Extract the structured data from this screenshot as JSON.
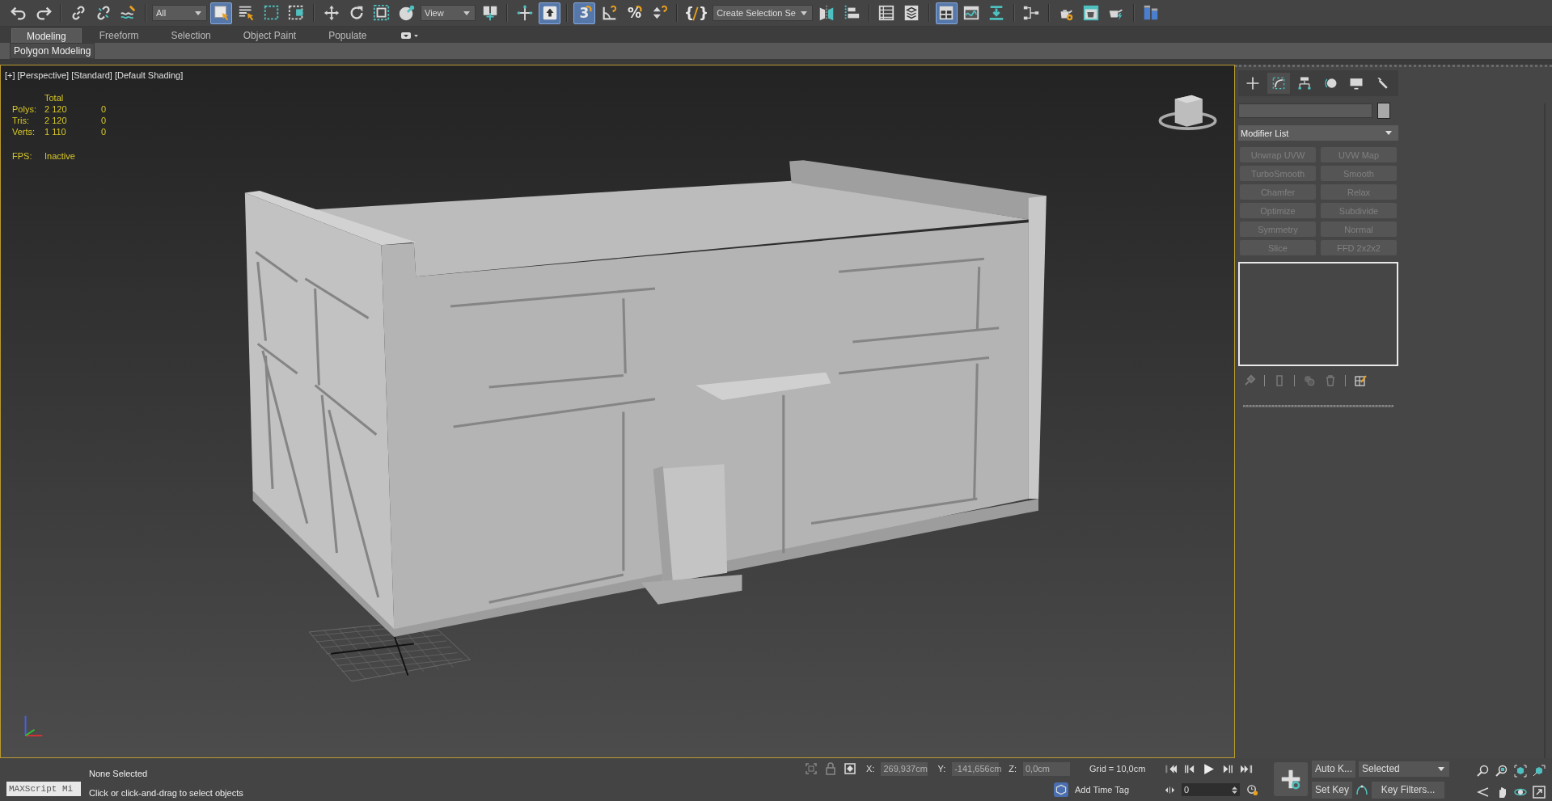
{
  "toolbar": [
    {
      "kind": "undo",
      "selected": false
    },
    {
      "kind": "redo",
      "selected": false
    },
    {
      "kind": "separator"
    },
    {
      "kind": "link",
      "selected": false
    },
    {
      "kind": "unlink",
      "selected": false
    },
    {
      "kind": "bind",
      "selected": false
    },
    {
      "kind": "separator"
    },
    {
      "kind": "dropdown",
      "value": "All"
    },
    {
      "kind": "select",
      "selected": true
    },
    {
      "kind": "select-by-name",
      "selected": false
    },
    {
      "kind": "rect-region",
      "selected": false
    },
    {
      "kind": "window-crossing",
      "selected": false
    },
    {
      "kind": "separator"
    },
    {
      "kind": "move",
      "selected": false
    },
    {
      "kind": "rotate",
      "selected": false
    },
    {
      "kind": "scale",
      "selected": false
    },
    {
      "kind": "place",
      "selected": false
    },
    {
      "kind": "dropdown",
      "value": "View"
    },
    {
      "kind": "pivot",
      "selected": false
    },
    {
      "kind": "separator"
    },
    {
      "kind": "manipulate",
      "selected": false
    },
    {
      "kind": "keyboard-override",
      "selected": true
    },
    {
      "kind": "separator"
    },
    {
      "kind": "snap",
      "label": "3",
      "selected": true
    },
    {
      "kind": "angle-snap",
      "selected": false
    },
    {
      "kind": "percent-snap",
      "label": "%",
      "selected": false
    },
    {
      "kind": "spinner-snap",
      "selected": false
    },
    {
      "kind": "separator"
    },
    {
      "kind": "named-selection",
      "label": "{ }",
      "selected": false
    },
    {
      "kind": "dropdown",
      "value": "Create Selection Se"
    },
    {
      "kind": "mirror",
      "selected": false
    },
    {
      "kind": "align",
      "selected": false
    },
    {
      "kind": "separator"
    },
    {
      "kind": "scene-explorer",
      "selected": false
    },
    {
      "kind": "layer-explorer",
      "selected": false
    },
    {
      "kind": "separator"
    },
    {
      "kind": "ribbon-toggle",
      "selected": true
    },
    {
      "kind": "curve-editor",
      "selected": false
    },
    {
      "kind": "arrow-down",
      "selected": false
    },
    {
      "kind": "separator"
    },
    {
      "kind": "schematic",
      "selected": false
    },
    {
      "kind": "separator"
    },
    {
      "kind": "render-setup",
      "selected": false
    },
    {
      "kind": "rendered-frame",
      "selected": false
    },
    {
      "kind": "render",
      "selected": false
    },
    {
      "kind": "separator"
    },
    {
      "kind": "workspace",
      "selected": false
    }
  ],
  "ribbon": {
    "tabs": [
      {
        "label": "Modeling",
        "selected": true
      },
      {
        "label": "Freeform",
        "selected": false
      },
      {
        "label": "Selection",
        "selected": false
      },
      {
        "label": "Object Paint",
        "selected": false
      },
      {
        "label": "Populate",
        "selected": false
      }
    ],
    "panel_button": "Polygon Modeling"
  },
  "viewport": {
    "active": true,
    "labels": [
      "[+]",
      "[Perspective]",
      "[Standard]",
      "[Default Shading]"
    ],
    "stats": {
      "header": "Total",
      "rows": [
        {
          "label": "Polys:",
          "total": "2 120",
          "selected": "0"
        },
        {
          "label": "Tris:",
          "total": "2 120",
          "selected": "0"
        },
        {
          "label": "Verts:",
          "total": "1 110",
          "selected": "0"
        }
      ],
      "fps_label": "FPS:",
      "fps_value": "Inactive"
    }
  },
  "command_panel": {
    "tabs": [
      {
        "kind": "create",
        "selected": false
      },
      {
        "kind": "modify",
        "selected": true
      },
      {
        "kind": "hierarchy",
        "selected": false
      },
      {
        "kind": "motion",
        "selected": false
      },
      {
        "kind": "display",
        "selected": false
      },
      {
        "kind": "utilities",
        "selected": false
      }
    ],
    "modifier_list": "Modifier List",
    "modifiers": [
      {
        "label": "Unwrap UVW",
        "disabled": true
      },
      {
        "label": "UVW Map",
        "disabled": true
      },
      {
        "label": "TurboSmooth",
        "disabled": true
      },
      {
        "label": "Smooth",
        "disabled": true
      },
      {
        "label": "Chamfer",
        "disabled": true
      },
      {
        "label": "Relax",
        "disabled": true
      },
      {
        "label": "Optimize",
        "disabled": true
      },
      {
        "label": "Subdivide",
        "disabled": true
      },
      {
        "label": "Symmetry",
        "disabled": true
      },
      {
        "label": "Normal",
        "disabled": true
      },
      {
        "label": "Slice",
        "disabled": true
      },
      {
        "label": "FFD 2x2x2",
        "disabled": true
      }
    ]
  },
  "status_bar": {
    "maxscript": "MAXScript Mi",
    "selection": "None Selected",
    "prompt": "Click or click-and-drag to select objects",
    "coords": [
      {
        "axis": "X:",
        "value": "269,937cm"
      },
      {
        "axis": "Y:",
        "value": "-141,656cm"
      },
      {
        "axis": "Z:",
        "value": "0,0cm"
      }
    ],
    "grid": "Grid = 10,0cm",
    "time_tag": "Add Time Tag",
    "frame": "0",
    "auto_key": "Auto K...",
    "key_mode": "Selected",
    "set_key": "Set Key",
    "key_filters": "Key Filters..."
  }
}
